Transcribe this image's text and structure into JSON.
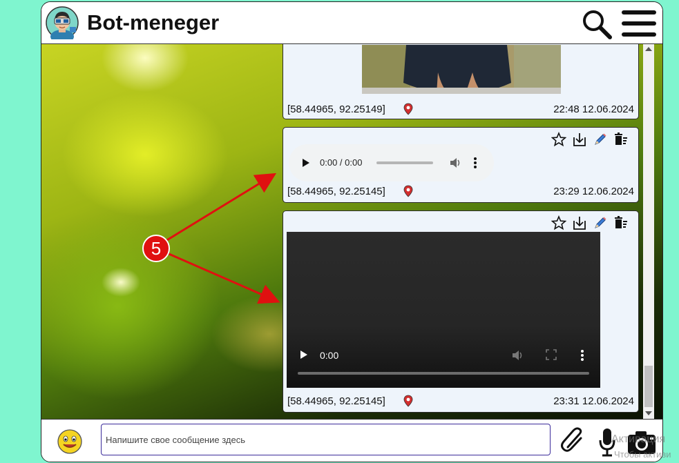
{
  "app": {
    "title": "Bot-meneger"
  },
  "header": {
    "search_icon": "search-icon",
    "menu_icon": "hamburger-menu-icon"
  },
  "messages": [
    {
      "coords": "[58.44965, 92.25149]",
      "time": "22:48 12.06.2024"
    },
    {
      "coords": "[58.44965, 92.25145]",
      "time": "23:29 12.06.2024",
      "audio": {
        "time": "0:00 / 0:00"
      },
      "actions": [
        "star-icon",
        "download-icon",
        "edit-pencil-icon",
        "delete-icon"
      ]
    },
    {
      "coords": "[58.44965, 92.25145]",
      "time": "23:31 12.06.2024",
      "video": {
        "time": "0:00"
      },
      "actions": [
        "star-icon",
        "download-icon",
        "edit-pencil-icon",
        "delete-icon"
      ]
    }
  ],
  "annotation": {
    "label": "5",
    "color": "#e01010"
  },
  "footer": {
    "input_placeholder": "Напишите свое сообщение здесь",
    "input_value": ""
  },
  "watermark": {
    "line1": "Активация",
    "line2": "Чтобы активи"
  },
  "colors": {
    "page_bg": "#7ff5cf",
    "message_bg": "#eef4fb",
    "pin": "#d32f2f"
  }
}
